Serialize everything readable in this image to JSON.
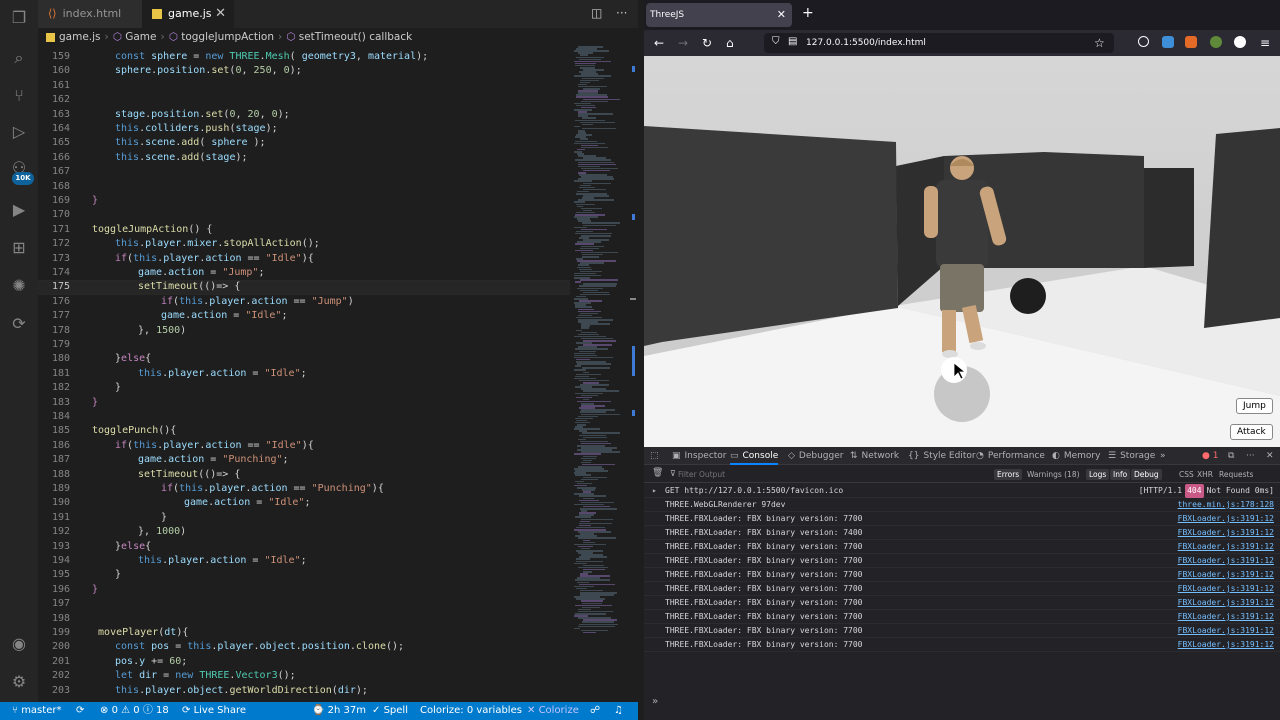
{
  "editor": {
    "tabs": [
      {
        "label": "index.html",
        "active": false
      },
      {
        "label": "game.js",
        "active": true
      }
    ],
    "breadcrumb": [
      "game.js",
      "Game",
      "toggleJumpAction",
      "setTimeout() callback"
    ],
    "activity_badge": "10K",
    "current_line": 175,
    "lines": [
      {
        "n": 159,
        "html": "<span class='kw'>const</span> <span class='var'>sphere</span> = <span class='kw'>new</span> <span class='cls'>THREE</span>.<span class='cls'>Mesh</span>( <span class='var'>geometry3</span>, <span class='var'>material</span>);",
        "indent": 2
      },
      {
        "n": 160,
        "html": "<span class='var'>sphere</span>.<span class='var'>position</span>.<span class='fn'>set</span>(<span class='num'>0</span>, <span class='num'>250</span>, <span class='num'>0</span>);",
        "indent": 2
      },
      {
        "n": 161,
        "html": "",
        "indent": 2
      },
      {
        "n": 162,
        "html": "",
        "indent": 2
      },
      {
        "n": 163,
        "html": "<span class='var'>stage</span>.<span class='var'>position</span>.<span class='fn'>set</span>(<span class='num'>0</span>, <span class='num'>20</span>, <span class='num'>0</span>);",
        "indent": 2
      },
      {
        "n": 164,
        "html": "<span class='kw'>this</span>.<span class='var'>colliders</span>.<span class='fn'>push</span>(<span class='var'>stage</span>);",
        "indent": 2
      },
      {
        "n": 165,
        "html": "<span class='kw'>this</span>.<span class='var'>scene</span>.<span class='fn'>add</span>( <span class='var'>sphere</span> );",
        "indent": 2
      },
      {
        "n": 166,
        "html": "<span class='kw'>this</span>.<span class='var'>scene</span>.<span class='fn'>add</span>(<span class='var'>stage</span>);",
        "indent": 2
      },
      {
        "n": 167,
        "html": "",
        "indent": 2
      },
      {
        "n": 168,
        "html": "",
        "indent": 2
      },
      {
        "n": 169,
        "html": "<span class='ctl'>}</span>",
        "indent": 1
      },
      {
        "n": 170,
        "html": "",
        "indent": 1
      },
      {
        "n": 171,
        "html": "<span class='fn'>toggleJumpAction</span>() {",
        "indent": 1
      },
      {
        "n": 172,
        "html": "<span class='kw'>this</span>.<span class='var'>player</span>.<span class='var'>mixer</span>.<span class='fn'>stopAllAction</span>();",
        "indent": 2
      },
      {
        "n": 173,
        "html": "<span class='ctl'>if</span>(<span class='kw'>this</span>.<span class='var'>player</span>.<span class='var'>action</span> == <span class='str'>\"Idle\"</span>){",
        "indent": 2
      },
      {
        "n": 174,
        "html": "<span class='var'>game</span>.<span class='var'>action</span> = <span class='str'>\"Jump\"</span>;",
        "indent": 3
      },
      {
        "n": 175,
        "html": "<span class='fn'>setTimeout</span>(()=> {",
        "indent": 3
      },
      {
        "n": 176,
        "html": "<span class='ctl'>if</span>(<span class='kw'>this</span>.<span class='var'>player</span>.<span class='var'>action</span> == <span class='str'>\"Jump\"</span>)",
        "indent": 4
      },
      {
        "n": 177,
        "html": "<span class='var'>game</span>.<span class='var'>action</span> = <span class='str'>\"Idle\"</span>;",
        "indent": 4
      },
      {
        "n": 178,
        "html": "}, <span class='num'>1500</span>)",
        "indent": 3
      },
      {
        "n": 179,
        "html": "",
        "indent": 3
      },
      {
        "n": 180,
        "html": "}<span class='ctl'>else</span>{",
        "indent": 2
      },
      {
        "n": 181,
        "html": "<span class='kw'>this</span>.<span class='var'>player</span>.<span class='var'>action</span> = <span class='str'>\"Idle\"</span>;",
        "indent": 3
      },
      {
        "n": 182,
        "html": "}",
        "indent": 2
      },
      {
        "n": 183,
        "html": "<span class='ctl'>}</span>",
        "indent": 1
      },
      {
        "n": 184,
        "html": "",
        "indent": 1
      },
      {
        "n": 185,
        "html": "<span class='fn'>togglePunch</span>(){",
        "indent": 1
      },
      {
        "n": 186,
        "html": "<span class='ctl'>if</span>(<span class='kw'>this</span>.<span class='var'>player</span>.<span class='var'>action</span> == <span class='str'>\"Idle\"</span>){",
        "indent": 2
      },
      {
        "n": 187,
        "html": "<span class='var'>game</span>.<span class='var'>action</span> = <span class='str'>\"Punching\"</span>;",
        "indent": 3
      },
      {
        "n": 188,
        "html": "<span class='fn'>setTimeout</span>(()=> {",
        "indent": 3
      },
      {
        "n": 189,
        "html": "<span class='ctl'>if</span>(<span class='kw'>this</span>.<span class='var'>player</span>.<span class='var'>action</span> == <span class='str'>\"Punching\"</span>){",
        "indent": 4
      },
      {
        "n": 190,
        "html": "<span class='var'>game</span>.<span class='var'>action</span> = <span class='str'>\"Idle\"</span>;",
        "indent": 5
      },
      {
        "n": 191,
        "html": "}",
        "indent": 4
      },
      {
        "n": 192,
        "html": "}, <span class='num'>1000</span>)",
        "indent": 3
      },
      {
        "n": 193,
        "html": "}<span class='ctl'>else</span>{",
        "indent": 2
      },
      {
        "n": 194,
        "html": "<span class='kw'>this</span>.<span class='var'>player</span>.<span class='var'>action</span> = <span class='str'>\"Idle\"</span>;",
        "indent": 3
      },
      {
        "n": 195,
        "html": "}",
        "indent": 2
      },
      {
        "n": 196,
        "html": "<span class='ctl'>}</span>",
        "indent": 1
      },
      {
        "n": 197,
        "html": "",
        "indent": 1
      },
      {
        "n": 198,
        "html": "",
        "indent": 1
      },
      {
        "n": 199,
        "html": " <span class='fn'>movePlayer</span>(<span class='var'>dt</span>){",
        "indent": 1
      },
      {
        "n": 200,
        "html": "<span class='kw'>const</span> <span class='var'>pos</span> = <span class='kw'>this</span>.<span class='var'>player</span>.<span class='var'>object</span>.<span class='var'>position</span>.<span class='fn'>clone</span>();",
        "indent": 2
      },
      {
        "n": 201,
        "html": "<span class='var'>pos</span>.<span class='var'>y</span> += <span class='num'>60</span>;",
        "indent": 2
      },
      {
        "n": 202,
        "html": "<span class='kw'>let</span> <span class='var'>dir</span> = <span class='kw'>new</span> <span class='cls'>THREE</span>.<span class='cls'>Vector3</span>();",
        "indent": 2
      },
      {
        "n": 203,
        "html": "<span class='kw'>this</span>.<span class='var'>player</span>.<span class='var'>object</span>.<span class='fn'>getWorldDirection</span>(<span class='var'>dir</span>);",
        "indent": 2
      }
    ],
    "status": {
      "branch": "master*",
      "problems_errors": "0",
      "problems_warnings": "0",
      "info_count": "18",
      "live_share": "Live Share",
      "time": "2h 37m",
      "spell": "Spell",
      "colorize_vars": "Colorize: 0 variables",
      "colorize": "Colorize"
    }
  },
  "browser": {
    "tab_title": "ThreeJS",
    "url": "127.0.0.1:5500/index.html",
    "game_buttons": {
      "jump": "Jump",
      "attack": "Attack"
    },
    "devtools": {
      "tabs": [
        "Inspector",
        "Console",
        "Debugger",
        "Network",
        "Style Editor",
        "Performance",
        "Memory",
        "Storage"
      ],
      "active_tab": "Console",
      "error_count": "1",
      "filter_placeholder": "Filter Output",
      "filters": [
        "Errors",
        "Warnings (18)",
        "Logs",
        "Info",
        "Debug"
      ],
      "extra_filters": [
        "CSS",
        "XHR",
        "Requests"
      ],
      "messages": [
        {
          "text": "GET http://127.0.0.1:5500/favicon.ico",
          "src": "",
          "status": "[HTTP/1.1",
          "code": "404",
          "status2": "Not Found 0ms]",
          "error": true
        },
        {
          "text": "THREE.WebGLRenderer 97dev",
          "src": "three.min.js:178:128"
        },
        {
          "text": "THREE.FBXLoader: FBX binary version: 7700",
          "src": "FBXLoader.js:3191:12"
        },
        {
          "text": "THREE.FBXLoader: FBX binary version: 7400",
          "src": "FBXLoader.js:3191:12"
        },
        {
          "text": "THREE.FBXLoader: FBX binary version: 7700",
          "src": "FBXLoader.js:3191:12"
        },
        {
          "text": "THREE.FBXLoader: FBX binary version: 7700",
          "src": "FBXLoader.js:3191:12"
        },
        {
          "text": "THREE.FBXLoader: FBX binary version: 7700",
          "src": "FBXLoader.js:3191:12"
        },
        {
          "text": "THREE.FBXLoader: FBX binary version: 7700",
          "src": "FBXLoader.js:3191:12"
        },
        {
          "text": "THREE.FBXLoader: FBX binary version: 7700",
          "src": "FBXLoader.js:3191:12"
        },
        {
          "text": "THREE.FBXLoader: FBX binary version: 7700",
          "src": "FBXLoader.js:3191:12"
        },
        {
          "text": "THREE.FBXLoader: FBX binary version: 7700",
          "src": "FBXLoader.js:3191:12"
        },
        {
          "text": "THREE.FBXLoader: FBX binary version: 7700",
          "src": "FBXLoader.js:3191:12"
        }
      ]
    }
  },
  "colors": {
    "accent": "#007acc",
    "firefox_blue": "#0a84ff",
    "error": "#c95a87"
  }
}
